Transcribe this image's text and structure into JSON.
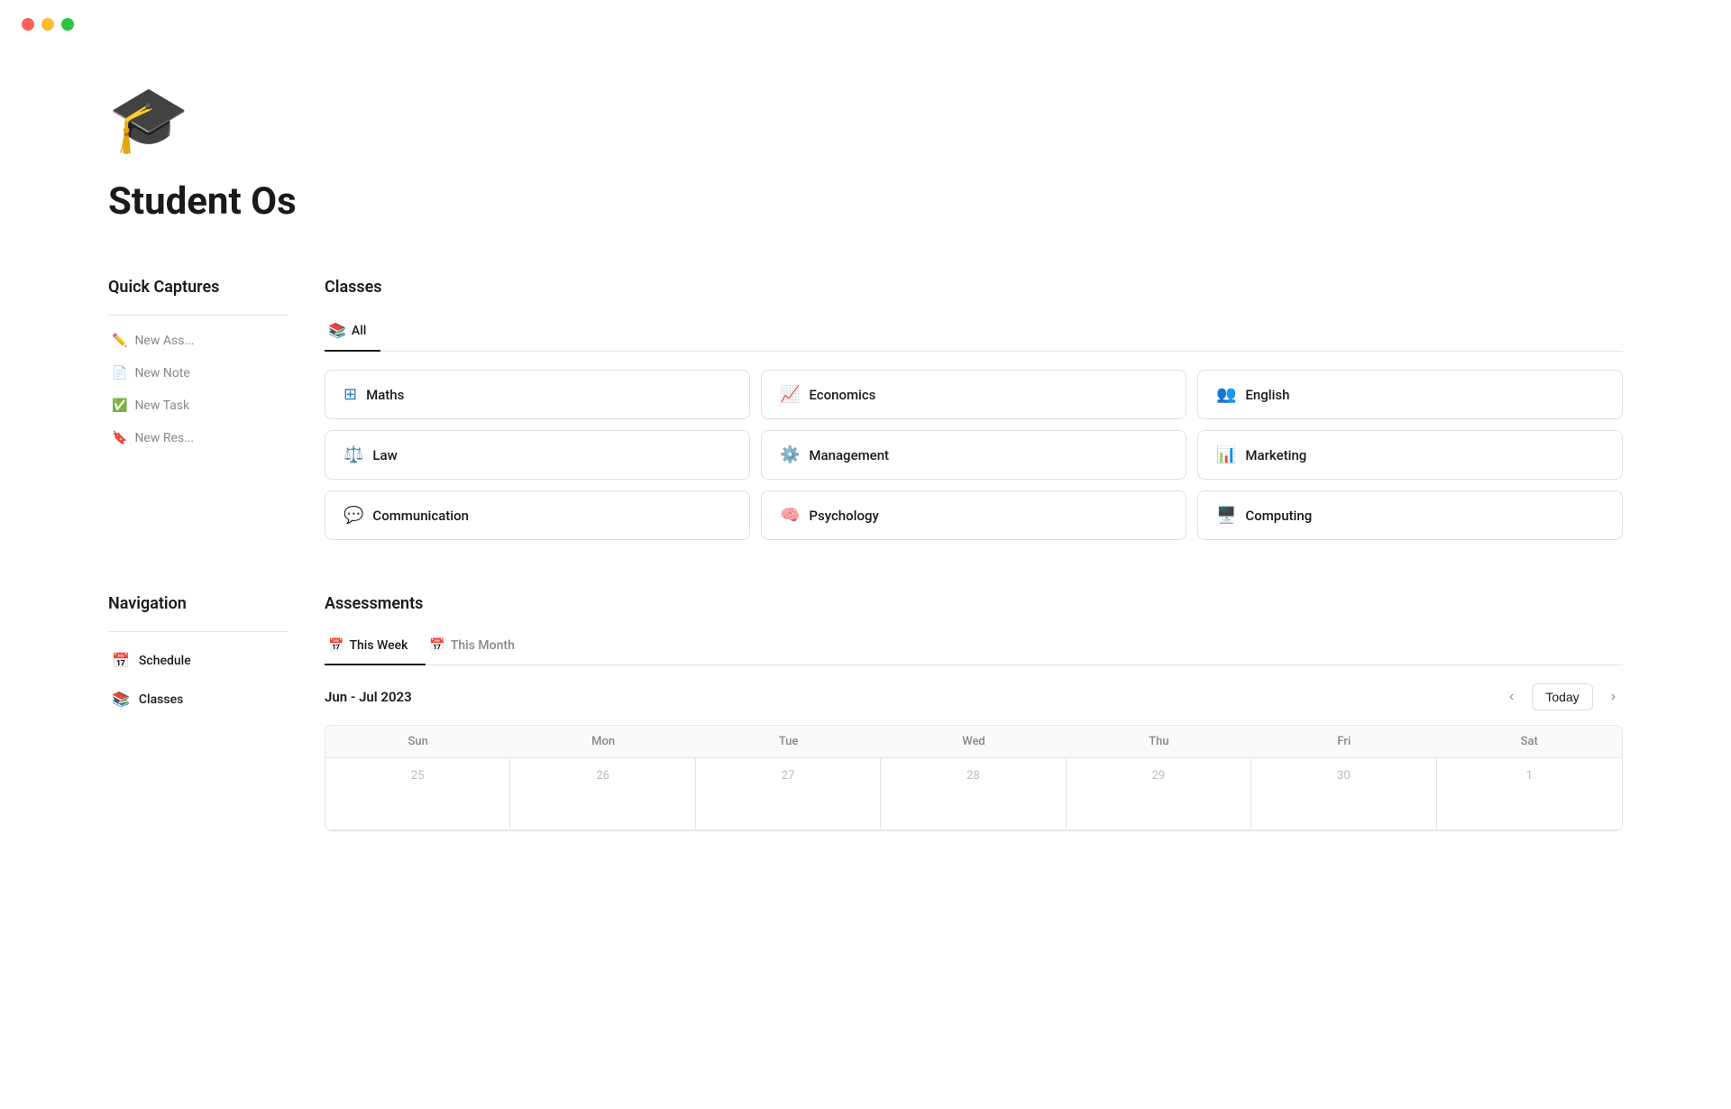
{
  "trafficLights": {
    "red": "red-close-button",
    "yellow": "yellow-minimize-button",
    "green": "green-maximize-button"
  },
  "app": {
    "logo": "🎓",
    "title": "Student Os"
  },
  "quickCaptures": {
    "header": "Quick Captures",
    "items": [
      {
        "id": "new-assignment",
        "icon": "✏️",
        "label": "New Ass..."
      },
      {
        "id": "new-note",
        "icon": "📄",
        "label": "New Note"
      },
      {
        "id": "new-task",
        "icon": "✅",
        "label": "New Task"
      },
      {
        "id": "new-resource",
        "icon": "🔖",
        "label": "New Res..."
      }
    ]
  },
  "classes": {
    "header": "Classes",
    "tabs": [
      {
        "id": "all",
        "icon": "📚",
        "label": "All",
        "active": true
      }
    ],
    "items": [
      {
        "id": "maths",
        "icon": "⊞",
        "label": "Maths"
      },
      {
        "id": "economics",
        "icon": "📈",
        "label": "Economics"
      },
      {
        "id": "english",
        "icon": "👥",
        "label": "English"
      },
      {
        "id": "law",
        "icon": "⚖️",
        "label": "Law"
      },
      {
        "id": "management",
        "icon": "⚙️",
        "label": "Management"
      },
      {
        "id": "marketing",
        "icon": "📊",
        "label": "Marketing"
      },
      {
        "id": "communication",
        "icon": "💬",
        "label": "Communication"
      },
      {
        "id": "psychology",
        "icon": "🧠",
        "label": "Psychology"
      },
      {
        "id": "computing",
        "icon": "🖥️",
        "label": "Computing"
      }
    ]
  },
  "navigation": {
    "header": "Navigation",
    "items": [
      {
        "id": "schedule",
        "icon": "📅",
        "label": "Schedule"
      },
      {
        "id": "classes",
        "icon": "📚",
        "label": "Classes"
      }
    ]
  },
  "assessments": {
    "header": "Assessments",
    "tabs": [
      {
        "id": "this-week",
        "icon": "📅",
        "label": "This Week",
        "active": true
      },
      {
        "id": "this-month",
        "icon": "📅",
        "label": "This Month",
        "active": false
      }
    ],
    "calendar": {
      "dateRange": "Jun - Jul 2023",
      "todayLabel": "Today",
      "days": [
        "Sun",
        "Mon",
        "Tue",
        "Wed",
        "Thu",
        "Fri",
        "Sat"
      ],
      "dates": [
        "25",
        "26",
        "27",
        "28",
        "29",
        "30",
        "1"
      ]
    }
  }
}
